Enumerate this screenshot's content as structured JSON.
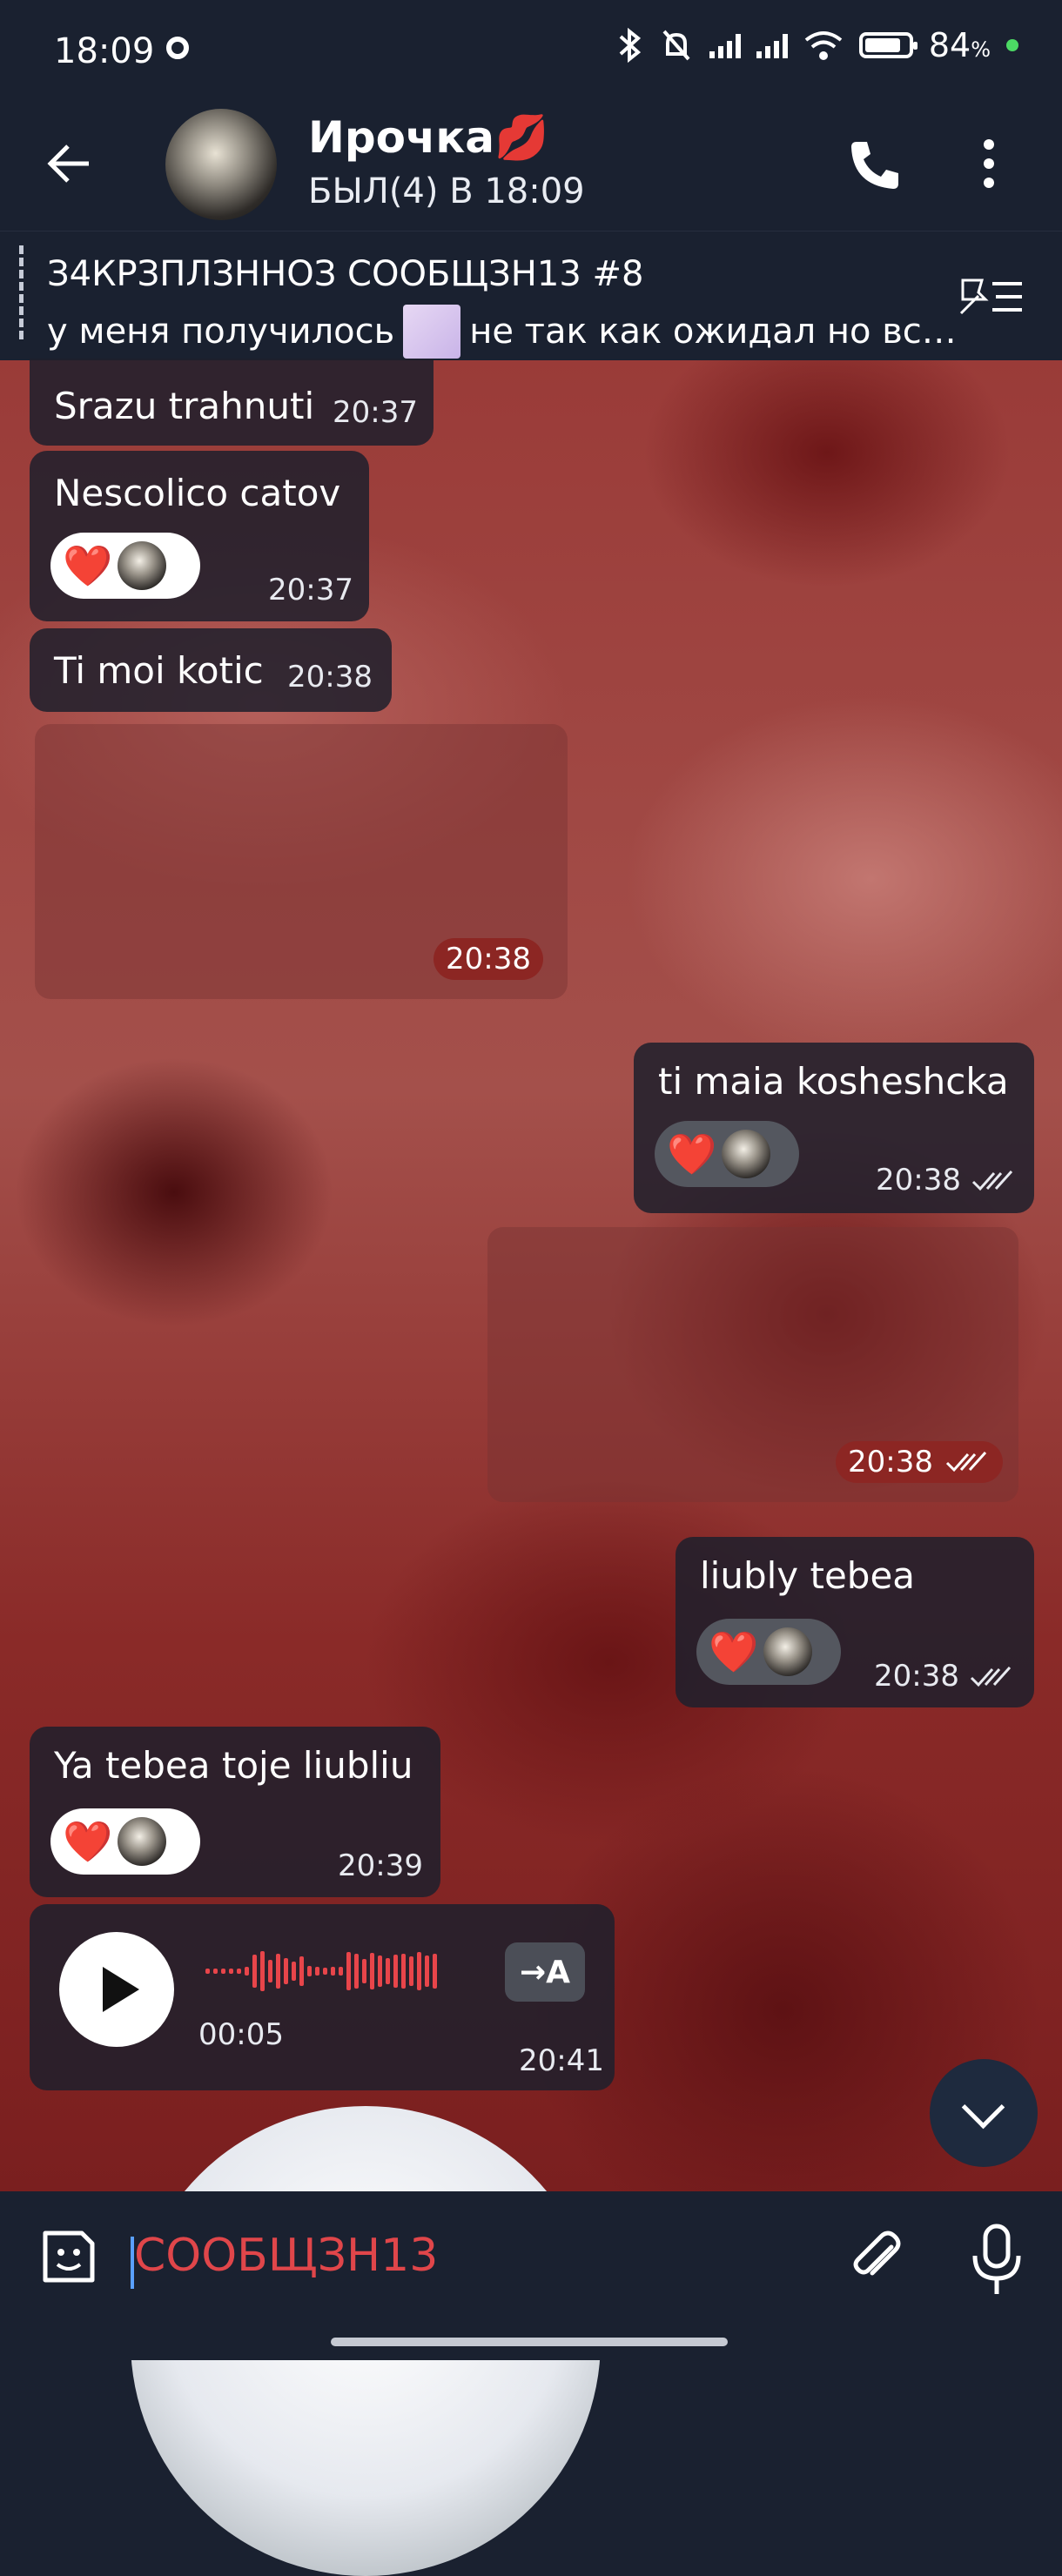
{
  "status_bar": {
    "time": "18:09",
    "battery": "84",
    "battery_unit": "%"
  },
  "chat_header": {
    "name": "Ирочка💋",
    "last_seen": "БЫЛ(4) В 18:09"
  },
  "pinned": {
    "title": "З4КРЗПЛЗННОЗ СООБЩЗН13 #8",
    "text_before": "у меня получилось",
    "text_after": "не так как ожидал но вс…"
  },
  "messages": [
    {
      "id": "m1",
      "direction": "in",
      "text": "Srazu trahnuti",
      "time": "20:37"
    },
    {
      "id": "m2",
      "direction": "in",
      "text": "Nescolico catov",
      "time": "20:37",
      "reaction": "❤️"
    },
    {
      "id": "m3",
      "direction": "in",
      "text": "Ti moi kotic",
      "time": "20:38"
    },
    {
      "id": "m4",
      "direction": "in",
      "type": "media",
      "time": "20:38"
    },
    {
      "id": "m5",
      "direction": "out",
      "text": "ti maia kosheshcka",
      "time": "20:38",
      "reaction": "❤️",
      "read": true
    },
    {
      "id": "m6",
      "direction": "out",
      "type": "media",
      "time": "20:38",
      "read": true
    },
    {
      "id": "m7",
      "direction": "out",
      "text": "liubly tebea",
      "time": "20:38",
      "reaction": "❤️",
      "read": true
    },
    {
      "id": "m8",
      "direction": "in",
      "text": "Ya tebea toje liubliu",
      "time": "20:39",
      "reaction": "❤️"
    },
    {
      "id": "m9",
      "direction": "in",
      "type": "voice",
      "duration": "00:05",
      "time": "20:41",
      "transcribe_label": "→A"
    }
  ],
  "input": {
    "placeholder": "СООБЩЗН13"
  },
  "colors": {
    "bar_background": "#1a2130",
    "bubble": "#1e202c",
    "accent_red": "#e0464a",
    "heart": "#e0182b"
  },
  "icons": [
    "back-arrow-icon",
    "phone-icon",
    "more-icon",
    "unpin-list-icon",
    "play-icon",
    "sticker-icon",
    "attach-icon",
    "mic-icon",
    "scroll-down-icon",
    "read-checks-icon",
    "heart-icon"
  ]
}
